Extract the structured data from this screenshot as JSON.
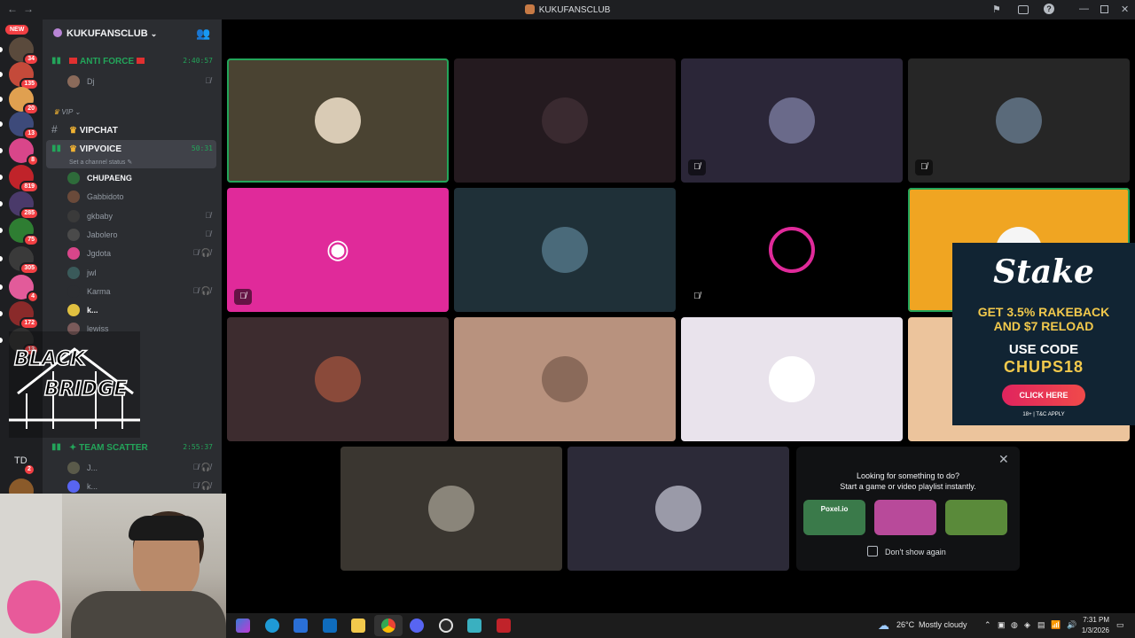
{
  "window": {
    "title": "KUKUFANSCLUB"
  },
  "rail": {
    "new_badge": "NEW",
    "servers": [
      {
        "badge": "34",
        "color": "#5a4a3c"
      },
      {
        "badge": "135",
        "color": "#c44a3a"
      },
      {
        "badge": "20",
        "color": "#e0a050"
      },
      {
        "badge": "13",
        "color": "#3d4a7a"
      },
      {
        "badge": "8",
        "color": "#d9468a"
      },
      {
        "badge": "819",
        "color": "#c0232a"
      },
      {
        "badge": "285",
        "color": "#4a3a6a"
      },
      {
        "badge": "75",
        "color": "#2e7d32"
      },
      {
        "badge": "305",
        "color": "#3a3a3a"
      },
      {
        "badge": "4",
        "color": "#e25b9a"
      },
      {
        "badge": "172",
        "color": "#8a2a2a"
      },
      {
        "badge": "13",
        "color": "#303030"
      }
    ],
    "td_label": "TD",
    "td_badge": "2"
  },
  "sidebar": {
    "server_name": "KUKUFANSCLUB",
    "channels": {
      "anti_force": {
        "name": "ANTI FORCE",
        "time": "2:40:57"
      },
      "category_vip": "VIP",
      "vipchat": "VIPCHAT",
      "vipvoice": {
        "name": "VIPVOICE",
        "time": "50:31",
        "status": "Set a channel status"
      },
      "team_scatter": {
        "name": "TEAM SCATTER",
        "time": "2:55:37"
      }
    },
    "anti_force_members": [
      {
        "name": "Dj"
      }
    ],
    "vipvoice_members": [
      {
        "name": "CHUPAENG",
        "bold": true,
        "color": "#2e6b3a",
        "icon": ""
      },
      {
        "name": "Gabbidoto",
        "bold": false,
        "color": "#6a4a3a",
        "icon": ""
      },
      {
        "name": "gkbaby",
        "bold": false,
        "color": "#3a3a3a",
        "icon": "mic-off"
      },
      {
        "name": "Jabolero",
        "bold": false,
        "color": "#4a4a4a",
        "icon": "mic-off"
      },
      {
        "name": "Jgdota",
        "bold": false,
        "color": "#d9468a",
        "icon": "mic-off deafen"
      },
      {
        "name": "jwl",
        "bold": false,
        "color": "#3a5a5a",
        "icon": ""
      },
      {
        "name": "Karma",
        "bold": false,
        "color": "#2b2d31",
        "icon": "mic-off deafen"
      },
      {
        "name": "k...",
        "bold": true,
        "color": "#e0c040",
        "icon": ""
      },
      {
        "name": "lewiss",
        "bold": false,
        "color": "#7a5a5a",
        "icon": ""
      }
    ],
    "team_scatter_members": [
      {
        "name": "J...",
        "color": "#5a5a4a"
      },
      {
        "name": "k...",
        "color": "#5865f2"
      }
    ]
  },
  "overlay": {
    "line1": "BLACK",
    "line2": "BRIDGE"
  },
  "tiles": [
    {
      "bg": "#4a4332",
      "av": "#d9cbb5",
      "active": true,
      "mute": false,
      "logo": false
    },
    {
      "bg": "#241a1f",
      "av": "#3a2a30",
      "active": false,
      "mute": false,
      "logo": false
    },
    {
      "bg": "#2b2638",
      "av": "#6a6a8a",
      "active": false,
      "mute": true,
      "logo": false
    },
    {
      "bg": "#262626",
      "av": "#5a6a7a",
      "active": false,
      "mute": true,
      "logo": false
    },
    {
      "bg": "#e02a9a",
      "av": "",
      "active": false,
      "mute": true,
      "logo": true
    },
    {
      "bg": "#1f3038",
      "av": "#4a6a7a",
      "active": false,
      "mute": false,
      "logo": false
    },
    {
      "bg": "#000000",
      "av": "",
      "active": false,
      "mute": true,
      "logo": false
    },
    {
      "bg": "#f0a522",
      "av": "#f5f5f5",
      "active": true,
      "mute": false,
      "logo": false
    },
    {
      "bg": "#3d2c2f",
      "av": "#8a4a3a",
      "active": false,
      "mute": false,
      "logo": false
    },
    {
      "bg": "#b8927e",
      "av": "#8a6a5a",
      "active": false,
      "mute": false,
      "logo": false
    },
    {
      "bg": "#e9e3ec",
      "av": "#ffffff",
      "active": false,
      "mute": false,
      "logo": false
    },
    {
      "bg": "#ecc49c",
      "av": "",
      "active": false,
      "mute": false,
      "logo": false
    },
    {
      "bg": "#3a3630",
      "av": "#8a857a",
      "active": false,
      "mute": false,
      "logo": false
    },
    {
      "bg": "#2c2a38",
      "av": "#9a9aa8",
      "active": false,
      "mute": false,
      "logo": false
    }
  ],
  "activity": {
    "line1": "Looking for something to do?",
    "line2": "Start a game or video playlist instantly.",
    "games": [
      {
        "name": "Poxel.io",
        "color": "#3a7a4a"
      },
      {
        "name": "",
        "color": "#b84a9a"
      },
      {
        "name": "",
        "color": "#5a8a3a"
      }
    ],
    "dont_show": "Don't show again"
  },
  "ad": {
    "brand": "Stake",
    "line1": "GET 3.5% RAKEBACK",
    "line2": "AND $7 RELOAD",
    "line3": "USE CODE",
    "code": "CHUPS18",
    "cta": "CLICK HERE",
    "fine": "18+ | T&C APPLY"
  },
  "taskbar": {
    "weather": "26°C",
    "condition": "Mostly cloudy",
    "time": "7:31 PM",
    "date": "1/3/2026"
  }
}
